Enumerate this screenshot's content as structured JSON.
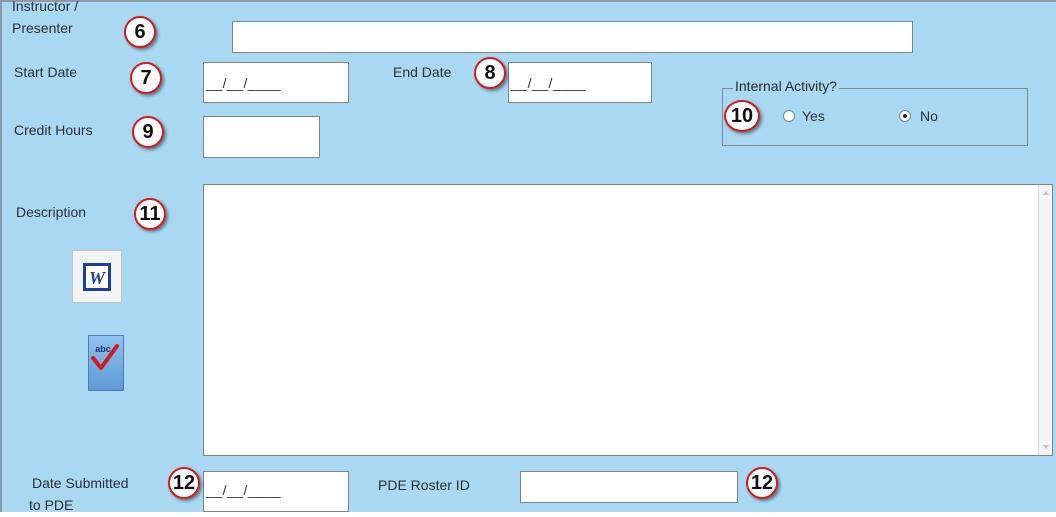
{
  "form": {
    "instructor_label_line1": "Instructor /",
    "instructor_label_line2": "Presenter",
    "instructor_value": "",
    "start_date_label": "Start Date",
    "start_date_value": "__/__/____",
    "end_date_label": "End Date",
    "end_date_value": "__/__/____",
    "internal_activity_label": "Internal Activity?",
    "radio_yes_label": "Yes",
    "radio_no_label": "No",
    "radio_selected": "No",
    "credit_hours_label": "Credit Hours",
    "credit_hours_value": "",
    "description_label": "Description",
    "description_value": "",
    "date_submitted_label_line1": "Date Submitted",
    "date_submitted_label_line2": "to PDE",
    "date_submitted_value": "__/__/____",
    "pde_roster_id_label": "PDE Roster ID",
    "pde_roster_id_value": ""
  },
  "callouts": {
    "instructor": "6",
    "start_date": "7",
    "end_date": "8",
    "credit_hours": "9",
    "internal_activity": "10",
    "description": "11",
    "date_submitted": "12",
    "pde_roster_id": "12"
  },
  "icons": {
    "word_button": "word-document-icon",
    "spell_button": "spell-check-icon",
    "word_glyph": "W",
    "spell_glyph": "abc"
  },
  "colors": {
    "background": "#a9d8f2",
    "callout_border": "#d41b1b",
    "spell_check": "#d41b1b"
  }
}
